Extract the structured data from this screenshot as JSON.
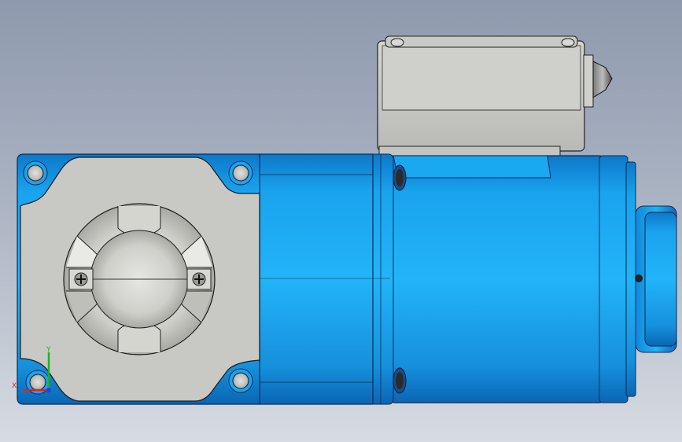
{
  "viewport": {
    "background_top": "#8e99ad",
    "background_bottom": "#d7dbe2"
  },
  "model": {
    "description_icon": "geared-motor-icon",
    "body_color": "#1aa3ee",
    "body_dark": "#0a6fc0",
    "gear_face_color": "#c8c8c4",
    "terminal_box_color": "#c4c5c0"
  },
  "triad": {
    "x_label": "X",
    "y_label": "Y",
    "x_color": "#e02020",
    "y_color": "#20b020",
    "z_color": "#2040e0"
  }
}
